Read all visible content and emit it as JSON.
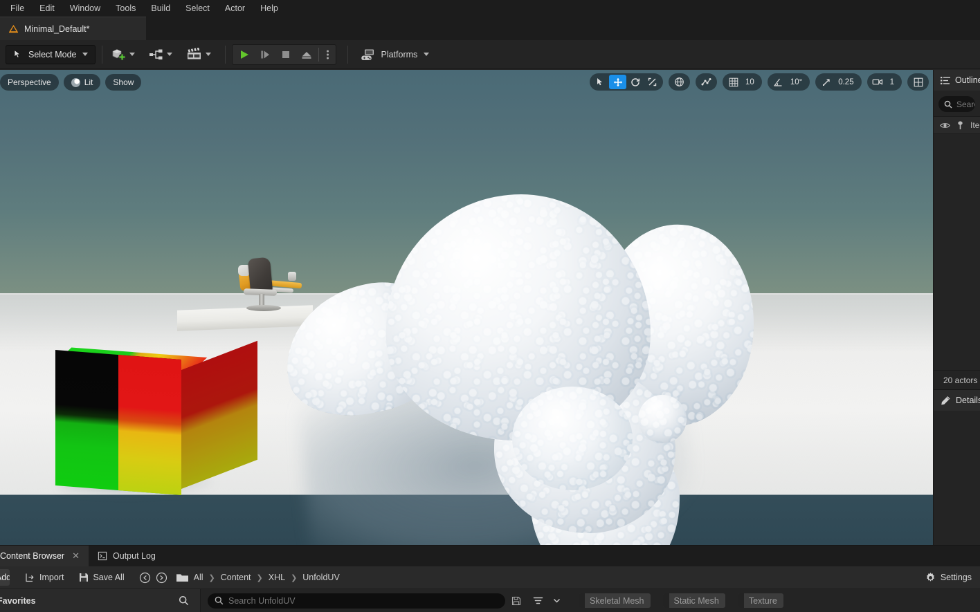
{
  "menubar": {
    "items": [
      {
        "label": "File"
      },
      {
        "label": "Edit"
      },
      {
        "label": "Window"
      },
      {
        "label": "Tools"
      },
      {
        "label": "Build"
      },
      {
        "label": "Select"
      },
      {
        "label": "Actor"
      },
      {
        "label": "Help"
      }
    ]
  },
  "level_tab": {
    "label": "Minimal_Default*",
    "icon": "unreal-logo-icon"
  },
  "toolbar": {
    "mode_label": "Select Mode",
    "mode_icon": "cursor-select-icon",
    "add_icon": "add-actor-icon",
    "blueprints_icon": "blueprints-icon",
    "cinematics_icon": "cinematics-clapperboard-icon",
    "play_icon": "play-icon",
    "step_icon": "step-forward-icon",
    "stop_icon": "stop-icon",
    "eject_icon": "eject-icon",
    "more_icon": "kebab-menu-icon",
    "platforms_label": "Platforms",
    "platforms_icon": "platforms-gamepad-icon"
  },
  "viewport": {
    "perspective_label": "Perspective",
    "lit_label": "Lit",
    "show_label": "Show",
    "tools": {
      "select_icon": "cursor-arrow-icon",
      "translate_icon": "move-gizmo-icon",
      "rotate_icon": "rotate-gizmo-icon",
      "scale_icon": "scale-gizmo-icon",
      "world_icon": "world-coordinate-globe-icon",
      "surface_snap_icon": "surface-snap-icon",
      "grid_snap_icon": "grid-snap-icon",
      "grid_snap_value": "10",
      "angle_snap_icon": "angle-snap-icon",
      "angle_snap_value": "10°",
      "scale_snap_icon": "scale-snap-icon",
      "scale_snap_value": "0.25",
      "camera_speed_icon": "camera-speed-icon",
      "camera_speed_value": "1",
      "maximize_icon": "viewport-layout-icon"
    },
    "active_tool": "translate",
    "accent_color": "#1a8fe8"
  },
  "outliner": {
    "tab_label": "Outliner",
    "tab_icon": "outliner-icon",
    "search_placeholder": "Search...",
    "col_visibility_icon": "eye-icon",
    "col_pin_icon": "pin-icon",
    "col_item_label": "Item Label",
    "status": "20 actors"
  },
  "details": {
    "tab_label": "Details",
    "tab_icon": "details-pencil-icon"
  },
  "content_browser": {
    "tabs": [
      {
        "label": "Content Browser",
        "icon": "content-browser-icon",
        "active": true,
        "closable": true
      },
      {
        "label": "Output Log",
        "icon": "output-log-icon",
        "active": false,
        "closable": false
      }
    ],
    "add_label": "Add",
    "import_label": "Import",
    "import_icon": "import-icon",
    "save_all_label": "Save All",
    "save_all_icon": "save-icon",
    "back_icon": "back-arrow-icon",
    "forward_icon": "forward-arrow-icon",
    "folder_icon": "folder-icon",
    "breadcrumb": [
      "All",
      "Content",
      "XHL",
      "UnfoldUV"
    ],
    "settings_label": "Settings",
    "settings_icon": "gear-icon",
    "favorites_label": "Favorites",
    "favorites_search_icon": "search-icon",
    "search_placeholder": "Search UnfoldUV",
    "search_icon": "search-icon",
    "save_search_icon": "save-search-icon",
    "filter_icon": "filter-icon",
    "filter_caret_icon": "chevron-down-icon",
    "filters": [
      {
        "label": "Skeletal Mesh"
      },
      {
        "label": "Static Mesh"
      },
      {
        "label": "Texture"
      }
    ]
  }
}
